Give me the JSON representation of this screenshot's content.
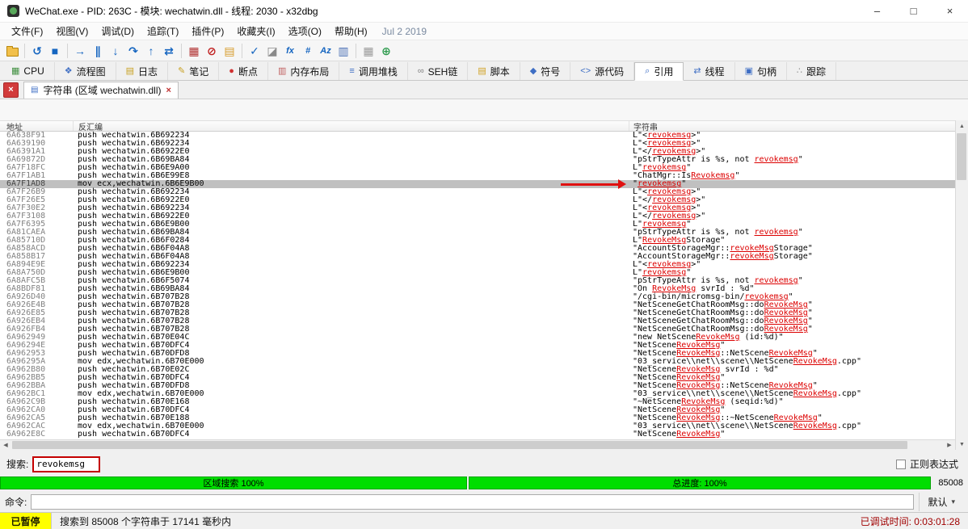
{
  "window": {
    "title": "WeChat.exe - PID: 263C - 模块: wechatwin.dll - 线程: 2030 - x32dbg",
    "controls": {
      "minimize": "–",
      "maximize": "□",
      "close": "×"
    }
  },
  "menu": {
    "items": [
      "文件(F)",
      "视图(V)",
      "调试(D)",
      "追踪(T)",
      "插件(P)",
      "收藏夹(I)",
      "选项(O)",
      "帮助(H)"
    ],
    "build_date": "Jul 2 2019"
  },
  "toolbar": {
    "items": [
      {
        "name": "open-file-icon",
        "type": "folder"
      },
      {
        "type": "sep"
      },
      {
        "name": "restart-icon",
        "glyph": "↺",
        "color": "#1565C0"
      },
      {
        "name": "stop-icon",
        "glyph": "■",
        "color": "#1565C0"
      },
      {
        "type": "sep"
      },
      {
        "name": "run-icon",
        "glyph": "→",
        "color": "#1565C0"
      },
      {
        "name": "pause-icon",
        "glyph": "∥",
        "color": "#1565C0"
      },
      {
        "name": "step-into-icon",
        "glyph": "↓",
        "color": "#1565C0"
      },
      {
        "name": "step-over-icon",
        "glyph": "↷",
        "color": "#1565C0"
      },
      {
        "name": "run-to-return-icon",
        "glyph": "↑",
        "color": "#1565C0"
      },
      {
        "name": "step-back-icon",
        "glyph": "⇄",
        "color": "#1565C0"
      },
      {
        "type": "sep"
      },
      {
        "name": "settings-icon",
        "glyph": "▦",
        "color": "#B03030"
      },
      {
        "name": "breakpoint-toggle-icon",
        "glyph": "⊘",
        "color": "#C02020"
      },
      {
        "name": "log-page-icon",
        "glyph": "▤",
        "color": "#D79B2A"
      },
      {
        "type": "sep"
      },
      {
        "name": "check-icon",
        "glyph": "✓",
        "color": "#1565C0"
      },
      {
        "name": "eraser-icon",
        "glyph": "◪",
        "color": "#8A8A8A"
      },
      {
        "name": "function-icon",
        "glyph": "fx",
        "color": "#1565C0",
        "text": true
      },
      {
        "name": "hash-icon",
        "glyph": "#",
        "color": "#1565C0",
        "text": true
      },
      {
        "name": "text-case-icon",
        "glyph": "Az",
        "color": "#1565C0",
        "text": true
      },
      {
        "name": "columns-icon",
        "glyph": "▥",
        "color": "#4A6FB5"
      },
      {
        "type": "sep"
      },
      {
        "name": "grid-icon",
        "glyph": "▦",
        "color": "#9A9A9A"
      },
      {
        "name": "globe-icon",
        "glyph": "⊕",
        "color": "#2E9B4E"
      }
    ]
  },
  "tabs": {
    "items": [
      {
        "id": "cpu",
        "label": "CPU",
        "glyph": "▦",
        "color": "#3E8E3E"
      },
      {
        "id": "graph",
        "label": "流程图",
        "glyph": "❖",
        "color": "#4472C4"
      },
      {
        "id": "log",
        "label": "日志",
        "glyph": "▤",
        "color": "#C8A020"
      },
      {
        "id": "notes",
        "label": "笔记",
        "glyph": "✎",
        "color": "#C8A020"
      },
      {
        "id": "breakpoints",
        "label": "断点",
        "glyph": "●",
        "color": "#D03030"
      },
      {
        "id": "memory-map",
        "label": "内存布局",
        "glyph": "▥",
        "color": "#C06060"
      },
      {
        "id": "call-stack",
        "label": "调用堆栈",
        "glyph": "≡",
        "color": "#3E6EC4"
      },
      {
        "id": "seh",
        "label": "SEH链",
        "glyph": "∞",
        "color": "#808080"
      },
      {
        "id": "script",
        "label": "脚本",
        "glyph": "▤",
        "color": "#D0A020"
      },
      {
        "id": "symbols",
        "label": "符号",
        "glyph": "◆",
        "color": "#3E6EC4"
      },
      {
        "id": "source",
        "label": "源代码",
        "glyph": "<>",
        "color": "#3E6EC4",
        "text": true
      },
      {
        "id": "references",
        "label": "引用",
        "glyph": "⌕",
        "color": "#3E6EC4",
        "active": true
      },
      {
        "id": "threads",
        "label": "线程",
        "glyph": "⇄",
        "color": "#3E6EC4"
      },
      {
        "id": "handles",
        "label": "句柄",
        "glyph": "▣",
        "color": "#3E6EC4"
      },
      {
        "id": "trace",
        "label": "跟踪",
        "glyph": "∴",
        "color": "#8A8A8A"
      }
    ]
  },
  "subtab": {
    "close_all_glyph": "×",
    "icon_glyph": "▤",
    "label": "字符串 (区域 wechatwin.dll)",
    "close_glyph": "×"
  },
  "table": {
    "columns": [
      "地址",
      "反汇编",
      "字符串"
    ],
    "rows": [
      {
        "addr": "6A638F91",
        "disasm": "push wechatwin.6B692234",
        "str": "L\"<revokemsg>\""
      },
      {
        "addr": "6A639190",
        "disasm": "push wechatwin.6B692234",
        "str": "L\"<revokemsg>\""
      },
      {
        "addr": "6A6391A1",
        "disasm": "push wechatwin.6B6922E0",
        "str": "L\"</revokemsg>\""
      },
      {
        "addr": "6A69872D",
        "disasm": "push wechatwin.6B69BA84",
        "str": "\"pStrTypeAttr is %s, not revokemsg\""
      },
      {
        "addr": "6A7F18FC",
        "disasm": "push wechatwin.6B6E9A00",
        "str": "L\"revokemsg\""
      },
      {
        "addr": "6A7F1AB1",
        "disasm": "push wechatwin.6B6E99E8",
        "str": "\"ChatMgr::IsRevokemsg\""
      },
      {
        "addr": "6A7F1AD8",
        "disasm": "mov ecx,wechatwin.6B6E9B00",
        "str": "\"revokemsg\"",
        "selected": true,
        "arrow": true
      },
      {
        "addr": "6A7F26B9",
        "disasm": "push wechatwin.6B692234",
        "str": "L\"<revokemsg>\""
      },
      {
        "addr": "6A7F26E5",
        "disasm": "push wechatwin.6B6922E0",
        "str": "L\"</revokemsg>\""
      },
      {
        "addr": "6A7F30E2",
        "disasm": "push wechatwin.6B692234",
        "str": "L\"<revokemsg>\""
      },
      {
        "addr": "6A7F3108",
        "disasm": "push wechatwin.6B6922E0",
        "str": "L\"</revokemsg>\""
      },
      {
        "addr": "6A7F6395",
        "disasm": "push wechatwin.6B6E9B00",
        "str": "L\"revokemsg\""
      },
      {
        "addr": "6A81CAEA",
        "disasm": "push wechatwin.6B69BA84",
        "str": "\"pStrTypeAttr is %s, not revokemsg\""
      },
      {
        "addr": "6A85710D",
        "disasm": "push wechatwin.6B6F0284",
        "str": "L\"RevokeMsgStorage\""
      },
      {
        "addr": "6A858ACD",
        "disasm": "push wechatwin.6B6F04A8",
        "str": "\"AccountStorageMgr::revokeMsgStorage\""
      },
      {
        "addr": "6A858B17",
        "disasm": "push wechatwin.6B6F04A8",
        "str": "\"AccountStorageMgr::revokeMsgStorage\""
      },
      {
        "addr": "6A894E9E",
        "disasm": "push wechatwin.6B692234",
        "str": "L\"<revokemsg>\""
      },
      {
        "addr": "6A8A750D",
        "disasm": "push wechatwin.6B6E9B00",
        "str": "L\"revokemsg\""
      },
      {
        "addr": "6A8AFC5B",
        "disasm": "push wechatwin.6B6F5074",
        "str": "\"pStrTypeAttr is %s, not revokemsg\""
      },
      {
        "addr": "6A8BDF81",
        "disasm": "push wechatwin.6B69BA84",
        "str": "\"On RevokeMsg svrId : %d\""
      },
      {
        "addr": "6A926D40",
        "disasm": "push wechatwin.6B707B28",
        "str": "\"/cgi-bin/micromsg-bin/revokemsg\""
      },
      {
        "addr": "6A926E4B",
        "disasm": "push wechatwin.6B707B28",
        "str": "\"NetSceneGetChatRoomMsg::doRevokeMsg\""
      },
      {
        "addr": "6A926E85",
        "disasm": "push wechatwin.6B707B28",
        "str": "\"NetSceneGetChatRoomMsg::doRevokeMsg\""
      },
      {
        "addr": "6A926EB4",
        "disasm": "push wechatwin.6B707B28",
        "str": "\"NetSceneGetChatRoomMsg::doRevokeMsg\""
      },
      {
        "addr": "6A926FB4",
        "disasm": "push wechatwin.6B707B28",
        "str": "\"NetSceneGetChatRoomMsg::doRevokeMsg\""
      },
      {
        "addr": "6A962949",
        "disasm": "push wechatwin.6B70E04C",
        "str": "\"new NetSceneRevokeMsg (id:%d)\""
      },
      {
        "addr": "6A96294E",
        "disasm": "push wechatwin.6B70DFC4",
        "str": "\"NetSceneRevokeMsg\""
      },
      {
        "addr": "6A962953",
        "disasm": "push wechatwin.6B70DFD8",
        "str": "\"NetSceneRevokeMsg::NetSceneRevokeMsg\""
      },
      {
        "addr": "6A96295A",
        "disasm": "mov edx,wechatwin.6B70E000",
        "str": "\"03_service\\\\net\\\\scene\\\\NetSceneRevokeMsg.cpp\""
      },
      {
        "addr": "6A962B80",
        "disasm": "push wechatwin.6B70E02C",
        "str": "\"NetSceneRevokeMsg svrId : %d\""
      },
      {
        "addr": "6A962BB5",
        "disasm": "push wechatwin.6B70DFC4",
        "str": "\"NetSceneRevokeMsg\""
      },
      {
        "addr": "6A962BBA",
        "disasm": "push wechatwin.6B70DFD8",
        "str": "\"NetSceneRevokeMsg::NetSceneRevokeMsg\""
      },
      {
        "addr": "6A962BC1",
        "disasm": "mov edx,wechatwin.6B70E000",
        "str": "\"03_service\\\\net\\\\scene\\\\NetSceneRevokeMsg.cpp\""
      },
      {
        "addr": "6A962C9B",
        "disasm": "push wechatwin.6B70E168",
        "str": "\"~NetSceneRevokeMsg (seqid:%d)\""
      },
      {
        "addr": "6A962CA0",
        "disasm": "push wechatwin.6B70DFC4",
        "str": "\"NetSceneRevokeMsg\""
      },
      {
        "addr": "6A962CA5",
        "disasm": "push wechatwin.6B70E188",
        "str": "\"NetSceneRevokeMsg::~NetSceneRevokeMsg\""
      },
      {
        "addr": "6A962CAC",
        "disasm": "mov edx,wechatwin.6B70E000",
        "str": "\"03_service\\\\net\\\\scene\\\\NetSceneRevokeMsg.cpp\""
      },
      {
        "addr": "6A962E8C",
        "disasm": "push wechatwin.6B70DFC4",
        "str": "\"NetSceneRevokeMsg\""
      }
    ]
  },
  "scrollbar": {
    "up": "▲",
    "down": "▼",
    "left": "◀",
    "right": "▶"
  },
  "search": {
    "label": "搜索:",
    "value": "revokemsg",
    "regex_label": "正则表达式",
    "regex_checked": false
  },
  "progress": {
    "left_label": "区域搜索 100%",
    "right_label": "总进度: 100%",
    "count": "85008"
  },
  "command": {
    "label": "命令:",
    "value": "",
    "profile": "默认",
    "dropdown_glyph": "▾"
  },
  "statusbar": {
    "state": "已暂停",
    "message": "搜索到 85008 个字符串于 17141 毫秒内",
    "debug_time": "已调试时间: 0:03:01:28"
  },
  "colors": {
    "selection": "#C0C0C0",
    "match_highlight": "#DC0000",
    "progress_green": "#00DE00",
    "paused_badge": "#FFFF00",
    "annotation_red": "#E01010"
  }
}
